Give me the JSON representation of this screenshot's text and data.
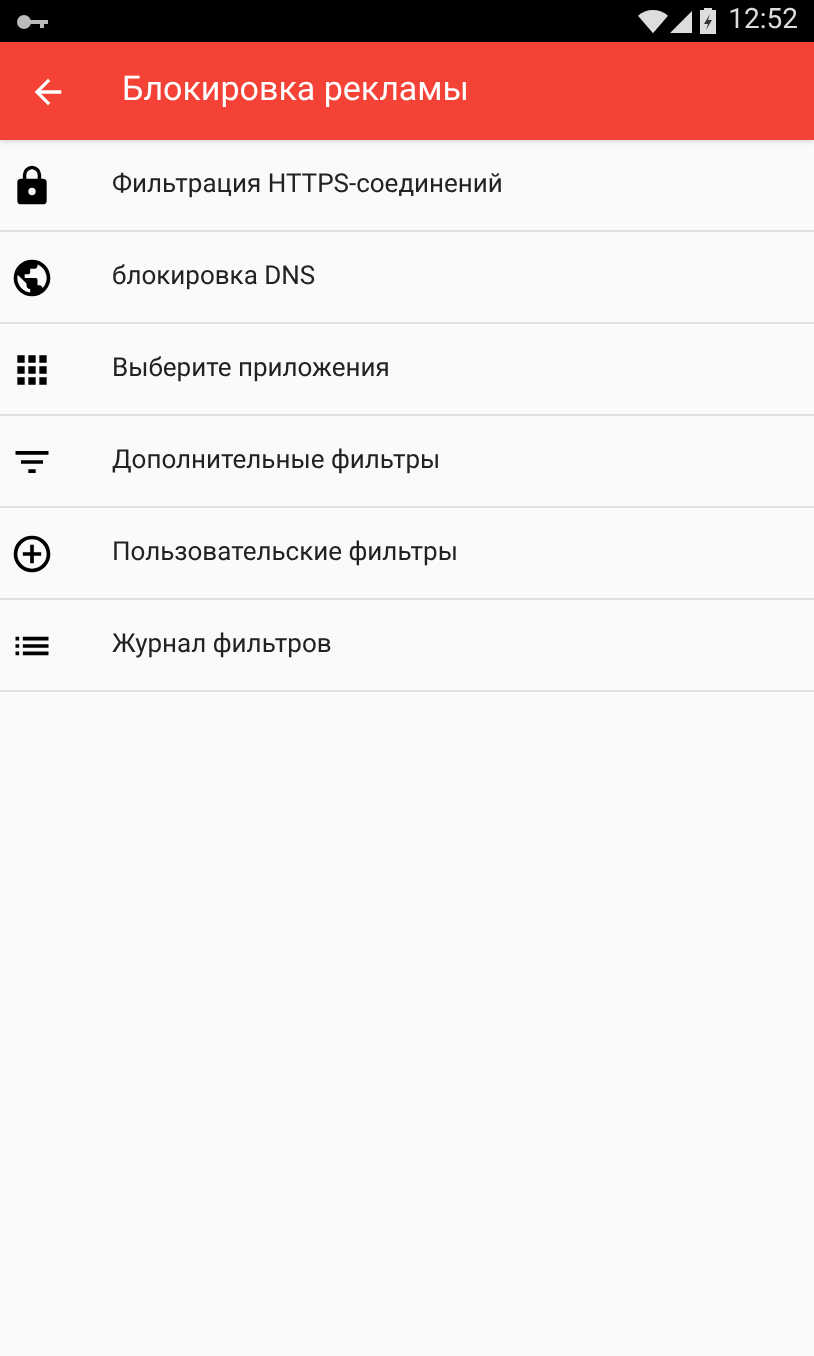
{
  "status_bar": {
    "time": "12:52"
  },
  "app_bar": {
    "title": "Блокировка рекламы"
  },
  "items": [
    {
      "label": "Фильтрация HTTPS-соединений",
      "kind": "lock"
    },
    {
      "label": "блокировка DNS",
      "kind": "globe"
    },
    {
      "label": "Выберите приложения",
      "kind": "apps"
    },
    {
      "label": "Дополнительные фильтры",
      "kind": "filter"
    },
    {
      "label": "Пользовательские фильтры",
      "kind": "add"
    },
    {
      "label": "Журнал фильтров",
      "kind": "list"
    }
  ]
}
